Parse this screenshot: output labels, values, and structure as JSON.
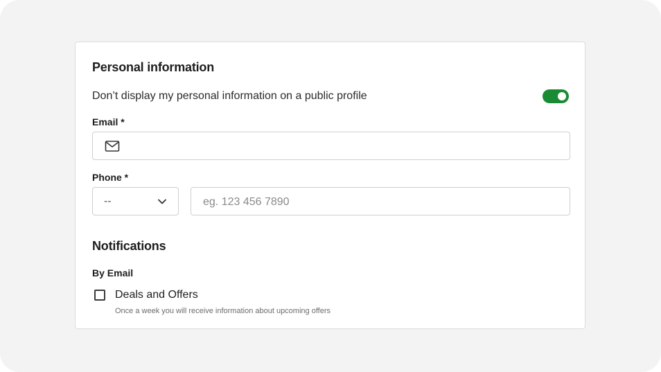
{
  "personal": {
    "title": "Personal information",
    "privacy_text": "Don’t display my personal information on a public profile",
    "privacy_toggle_on": true
  },
  "email": {
    "label": "Email *",
    "value": "",
    "icon": "mail-icon"
  },
  "phone": {
    "label": "Phone *",
    "country_value": "--",
    "number_value": "",
    "placeholder": "eg. 123 456 7890"
  },
  "notifications": {
    "title": "Notifications",
    "by_email_label": "By Email",
    "deals": {
      "label": "Deals and Offers",
      "help": "Once a week you will receive information about upcoming offers",
      "checked": false
    }
  },
  "colors": {
    "accent": "#1a8b35",
    "background": "#f3f3f3",
    "card": "#ffffff"
  }
}
